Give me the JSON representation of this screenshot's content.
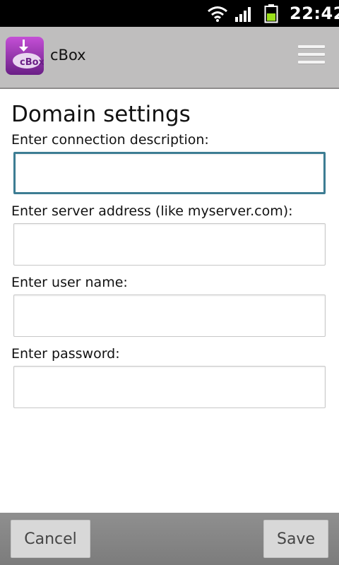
{
  "status_bar": {
    "time": "22:42",
    "icons": [
      "wifi-icon",
      "signal-icon",
      "battery-icon"
    ]
  },
  "action_bar": {
    "app_title": "cBox",
    "app_icon_text": "cBox",
    "menu_icon": "menu-icon"
  },
  "form": {
    "title": "Domain settings",
    "fields": [
      {
        "label": "Enter connection description:",
        "value": ""
      },
      {
        "label": "Enter server address (like myserver.com):",
        "value": ""
      },
      {
        "label": "Enter user name:",
        "value": ""
      },
      {
        "label": "Enter password:",
        "value": ""
      }
    ]
  },
  "bottom_bar": {
    "cancel_label": "Cancel",
    "save_label": "Save"
  },
  "colors": {
    "action_bar_bg": "#bfbebe",
    "focus_border": "#3d7d93",
    "bottom_bar_bg": "#858585"
  }
}
